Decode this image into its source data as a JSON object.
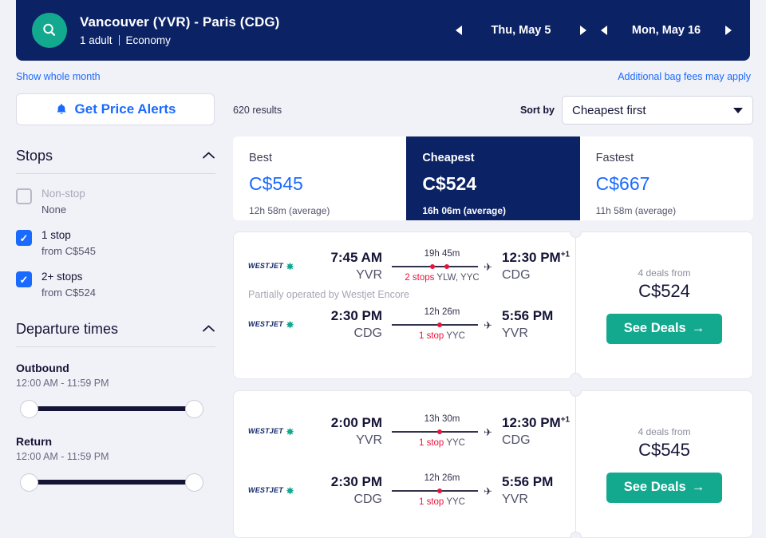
{
  "header": {
    "search_icon": "search-icon",
    "route_title": "Vancouver (YVR) - Paris (CDG)",
    "passengers": "1 adult",
    "cabin_class": "Economy",
    "depart_date": "Thu, May 5",
    "return_date": "Mon, May 16"
  },
  "links": {
    "whole_month": "Show whole month",
    "bag_fees": "Additional bag fees may apply"
  },
  "sidebar": {
    "price_alerts_label": "Get Price Alerts",
    "price_alerts_icon": "bell-icon",
    "stops": {
      "title": "Stops",
      "options": [
        {
          "label": "Non-stop",
          "sub": "None",
          "checked": false,
          "disabled": true
        },
        {
          "label": "1 stop",
          "sub": "from C$545",
          "checked": true,
          "disabled": false
        },
        {
          "label": "2+ stops",
          "sub": "from C$524",
          "checked": true,
          "disabled": false
        }
      ]
    },
    "departure_times": {
      "title": "Departure times",
      "sliders": [
        {
          "name": "Outbound",
          "range": "12:00 AM - 11:59 PM"
        },
        {
          "name": "Return",
          "range": "12:00 AM - 11:59 PM"
        }
      ]
    }
  },
  "results": {
    "count_label": "620 results",
    "sort_label": "Sort by",
    "sort_value": "Cheapest first",
    "tabs": [
      {
        "name": "Best",
        "price": "C$545",
        "duration": "12h 58m (average)",
        "active": false
      },
      {
        "name": "Cheapest",
        "price": "C$524",
        "duration": "16h 06m (average)",
        "active": true
      },
      {
        "name": "Fastest",
        "price": "C$667",
        "duration": "11h 58m (average)",
        "active": false
      }
    ],
    "cards": [
      {
        "outbound": {
          "airline": "WESTJET",
          "depart_time": "7:45 AM",
          "depart_code": "YVR",
          "duration": "19h 45m",
          "stops_count": "2 stops",
          "stops_codes": "YLW, YYC",
          "arrive_time": "12:30 PM",
          "arrive_day_offset": "+1",
          "arrive_code": "CDG"
        },
        "operated_note": "Partially operated by Westjet Encore",
        "inbound": {
          "airline": "WESTJET",
          "depart_time": "2:30 PM",
          "depart_code": "CDG",
          "duration": "12h 26m",
          "stops_count": "1 stop",
          "stops_codes": "YYC",
          "arrive_time": "5:56 PM",
          "arrive_day_offset": "",
          "arrive_code": "YVR"
        },
        "deals_from": "4 deals from",
        "deals_price": "C$524",
        "deals_button": "See Deals"
      },
      {
        "outbound": {
          "airline": "WESTJET",
          "depart_time": "2:00 PM",
          "depart_code": "YVR",
          "duration": "13h 30m",
          "stops_count": "1 stop",
          "stops_codes": "YYC",
          "arrive_time": "12:30 PM",
          "arrive_day_offset": "+1",
          "arrive_code": "CDG"
        },
        "operated_note": "",
        "inbound": {
          "airline": "WESTJET",
          "depart_time": "2:30 PM",
          "depart_code": "CDG",
          "duration": "12h 26m",
          "stops_count": "1 stop",
          "stops_codes": "YYC",
          "arrive_time": "5:56 PM",
          "arrive_day_offset": "",
          "arrive_code": "YVR"
        },
        "deals_from": "4 deals from",
        "deals_price": "C$545",
        "deals_button": "See Deals"
      }
    ]
  },
  "colors": {
    "navy": "#0b2265",
    "teal": "#12a98e",
    "blue_link": "#1a6aff",
    "red_stop": "#e8143c",
    "page_bg": "#f1f1f8"
  }
}
